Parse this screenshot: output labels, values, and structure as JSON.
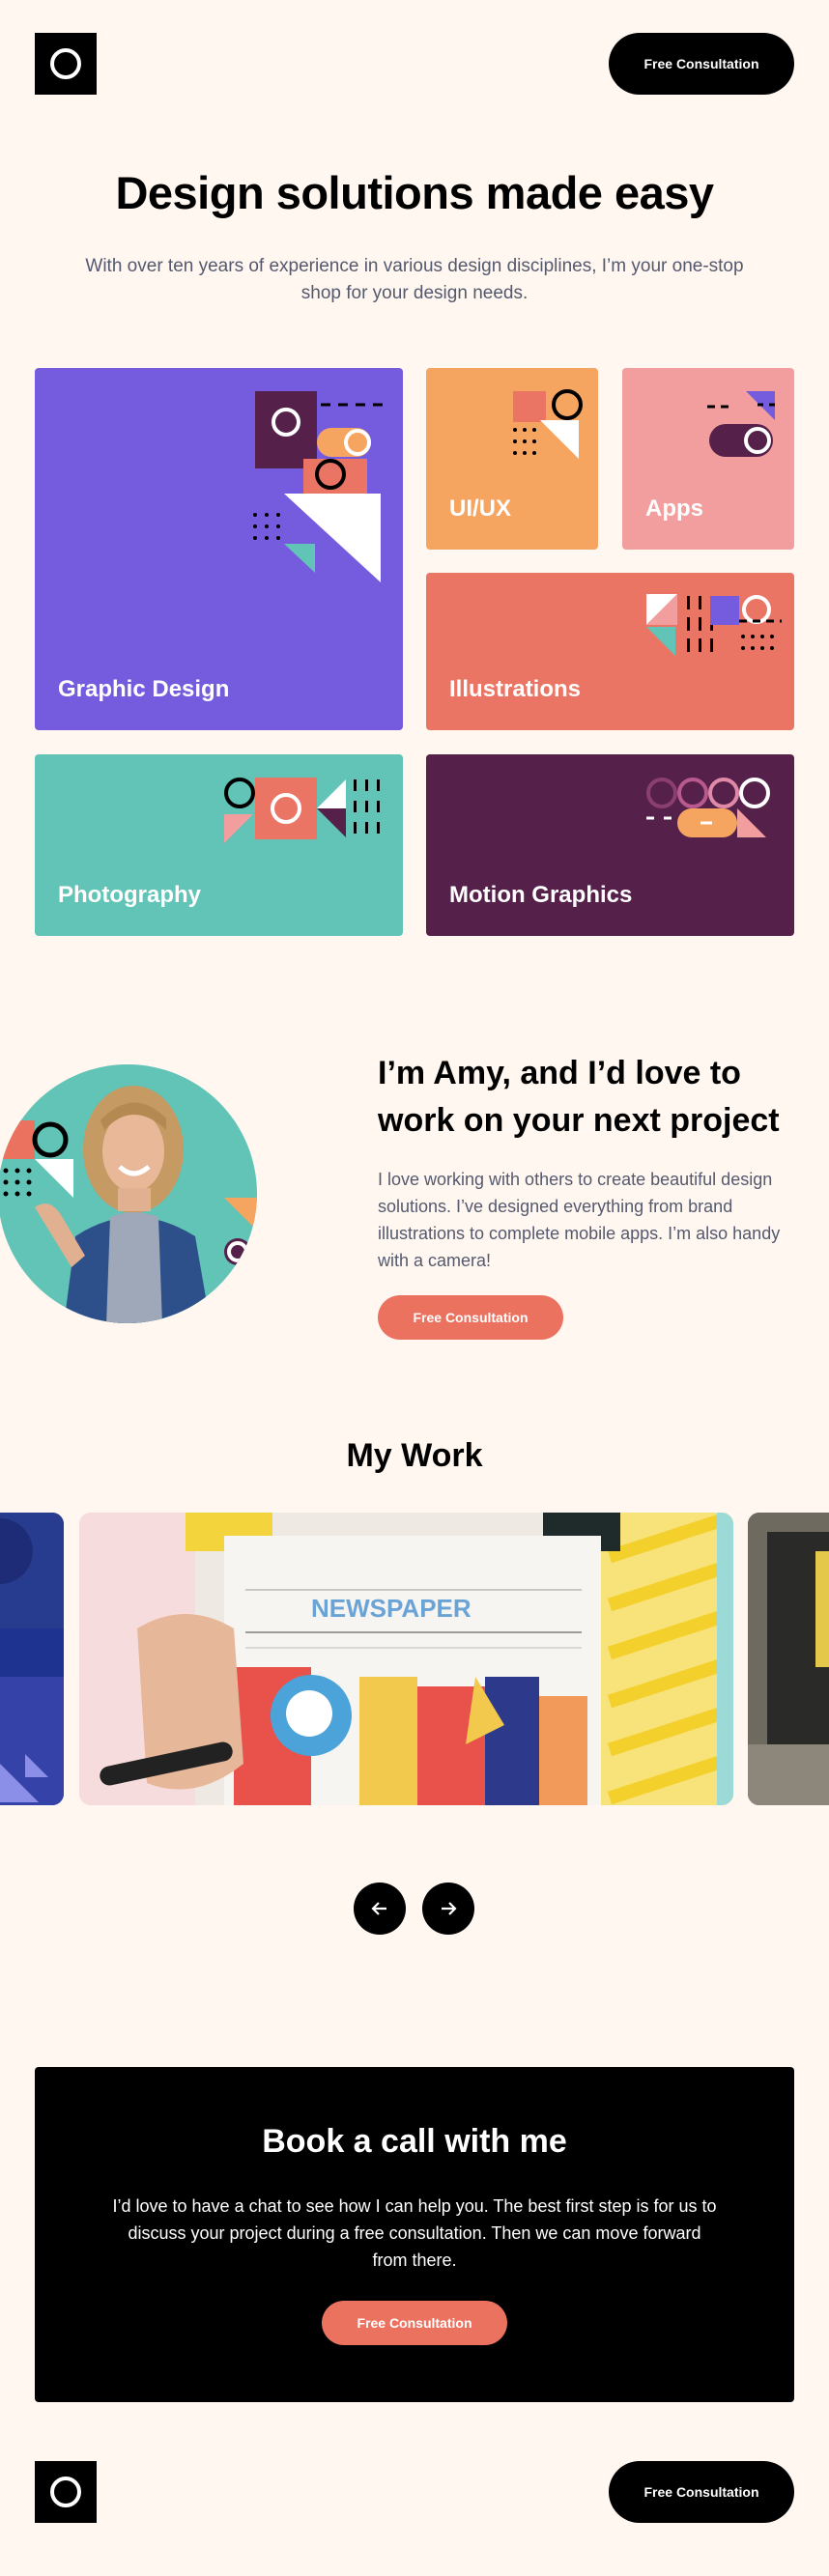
{
  "header": {
    "cta_label": "Free Consultation"
  },
  "hero": {
    "title": "Design solutions made easy",
    "subtitle": "With over ten years of experience in various design disciplines, I’m your one-stop shop for your design needs."
  },
  "services": [
    {
      "label": "Graphic Design",
      "color": "#755CDE"
    },
    {
      "label": "UI/UX",
      "color": "#F6A560"
    },
    {
      "label": "Apps",
      "color": "#F39E9E"
    },
    {
      "label": "Illustrations",
      "color": "#EB7565"
    },
    {
      "label": "Photography",
      "color": "#61C4B7"
    },
    {
      "label": "Motion Graphics",
      "color": "#552049"
    }
  ],
  "about": {
    "heading": "I’m Amy, and I’d love to work on your next project",
    "body": "I love working with others to create beautiful design solutions. I’ve designed everything from brand illustrations to complete mobile apps. I’m also handy with a camera!",
    "cta_label": "Free Consultation"
  },
  "work": {
    "heading": "My Work",
    "newspaper_title": "NEWSPAPER"
  },
  "book": {
    "heading": "Book a call with me",
    "body": "I’d love to have a chat to see how I can help you. The best first step is for us to discuss your project during a free consultation. Then we can move forward from there.",
    "cta_label": "Free Consultation"
  },
  "footer": {
    "cta_label": "Free Consultation"
  },
  "colors": {
    "background": "#FFF7F0",
    "coral": "#EC7260",
    "purple": "#755CDE",
    "teal": "#61C4B7",
    "plum": "#552049",
    "orange": "#F6A560",
    "pink": "#F39E9E"
  }
}
